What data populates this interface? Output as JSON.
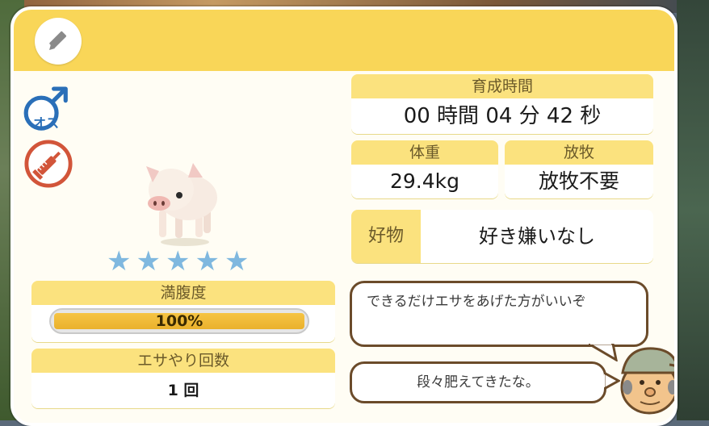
{
  "icons": {
    "edit": "pencil-icon",
    "gender": "male-symbol-icon",
    "vaccine": "syringe-icon",
    "star": "star-icon",
    "animal": "pig-icon",
    "npc": "farmer-icon"
  },
  "animal": {
    "gender_label": "オス",
    "rating": 5,
    "rating_max": 5
  },
  "fullness": {
    "label": "満腹度",
    "value_text": "100%",
    "percent": 100
  },
  "feed_count": {
    "label": "エサやり回数",
    "value": "1 回"
  },
  "growth_time": {
    "label": "育成時間",
    "value": "00 時間 04 分 42 秒"
  },
  "weight": {
    "label": "体重",
    "value": "29.4kg"
  },
  "grazing": {
    "label": "放牧",
    "value": "放牧不要"
  },
  "favorite": {
    "label": "好物",
    "value": "好き嫌いなし"
  },
  "speech": {
    "first": "できるだけエサをあげた方がいいぞ",
    "second": "段々肥えてきたな。"
  },
  "colors": {
    "header": "#f9d658",
    "male_blue": "#2a6fb8",
    "vaccine_red": "#d2553a",
    "star": "#7fb8df",
    "bar_fill": "#eab12c"
  }
}
